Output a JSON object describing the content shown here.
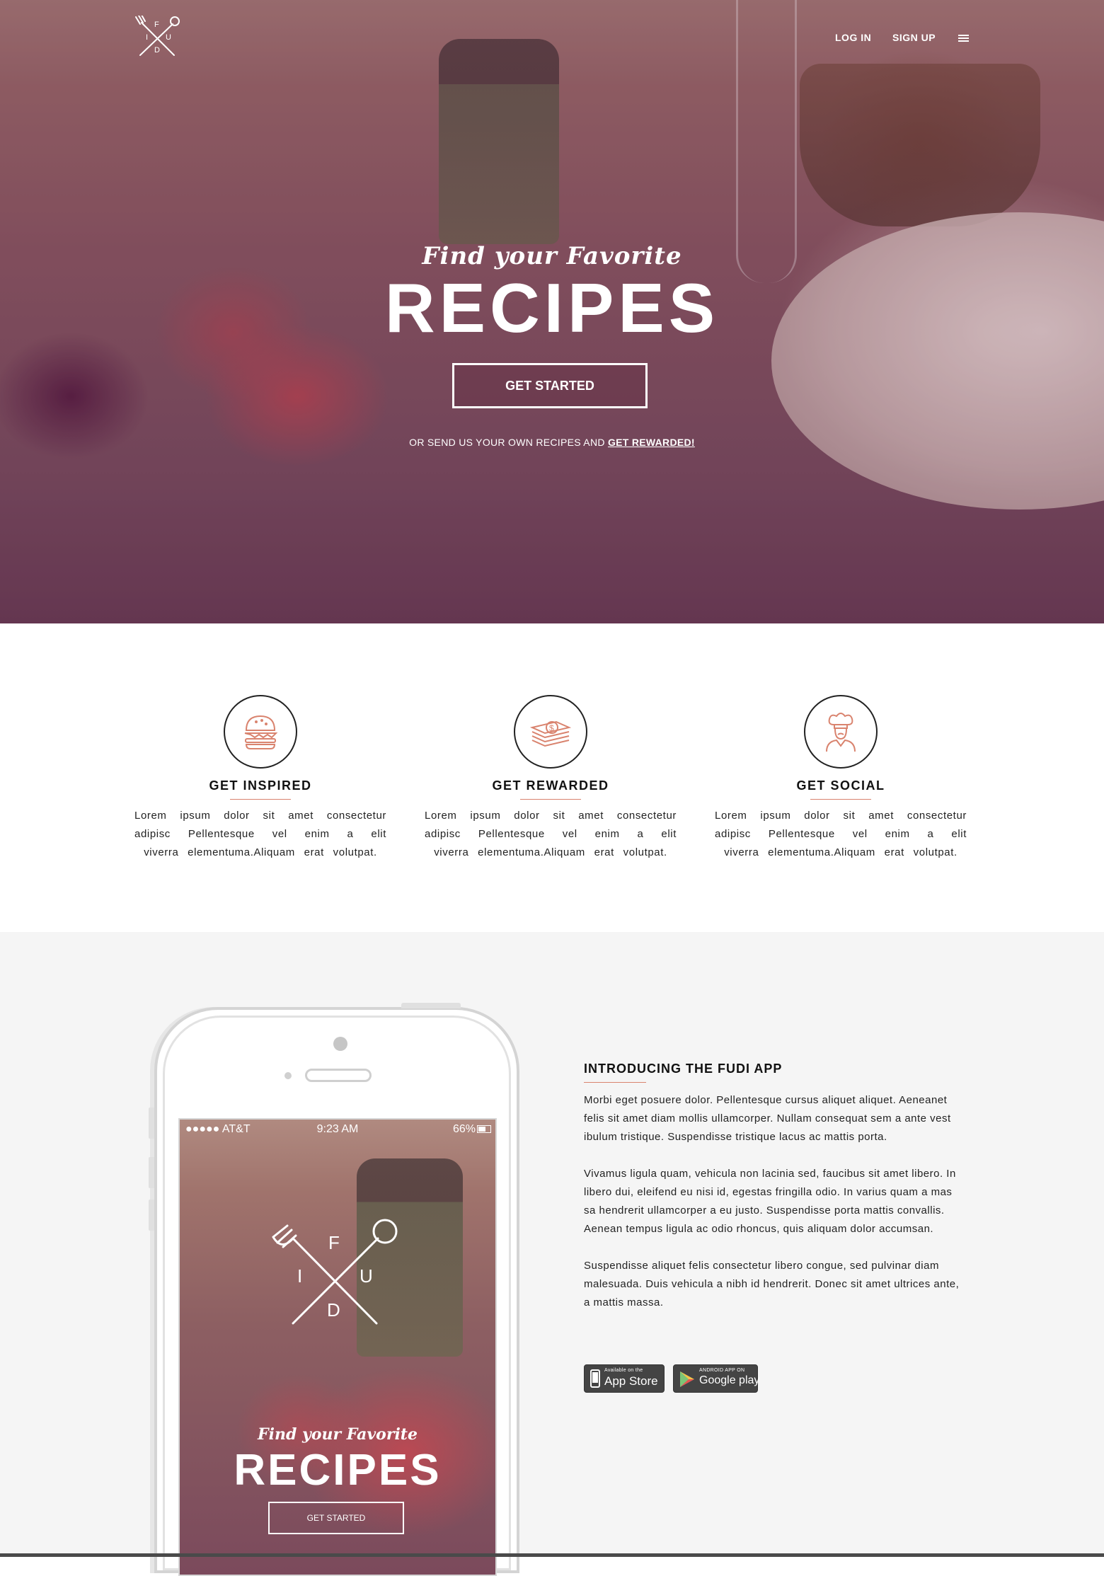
{
  "brand": {
    "logo_letters": [
      "F",
      "I",
      "U",
      "D"
    ]
  },
  "nav": {
    "login": "LOG IN",
    "signup": "SIGN UP"
  },
  "hero": {
    "subtitle": "Find your Favorite",
    "title": "RECIPES",
    "cta": "GET STARTED",
    "note_prefix": "OR SEND US YOUR OWN RECIPES AND",
    "note_link": "GET REWARDED!"
  },
  "features": [
    {
      "icon": "burger-icon",
      "title": "GET INSPIRED",
      "text": "Lorem ipsum dolor sit amet consectetur adipisc Pellentesque vel enim a elit viverra elementuma.Aliquam erat volutpat."
    },
    {
      "icon": "money-icon",
      "title": "GET REWARDED",
      "text": "Lorem ipsum dolor sit amet consectetur adipisc Pellentesque vel enim a elit viverra elementuma.Aliquam erat volutpat."
    },
    {
      "icon": "chef-icon",
      "title": "GET SOCIAL",
      "text": "Lorem ipsum dolor sit amet consectetur adipisc Pellentesque vel enim a elit viverra elementuma.Aliquam erat volutpat."
    }
  ],
  "phone": {
    "carrier": "●●●●● AT&T",
    "time": "9:23 AM",
    "battery": "66%",
    "subtitle": "Find your Favorite",
    "title": "RECIPES",
    "cta": "GET STARTED"
  },
  "app": {
    "heading": "INTRODUCING THE FUDI APP",
    "paragraphs": [
      "Morbi eget posuere dolor. Pellentesque cursus aliquet aliquet. Aeneanet felis sit amet diam mollis ullamcorper. Nullam consequat sem a ante vest ibulum tristique. Suspendisse tristique lacus ac mattis porta.",
      "Vivamus ligula quam, vehicula non lacinia sed, faucibus sit amet libero. In libero dui, eleifend eu nisi id, egestas fringilla odio. In varius quam a mas sa hendrerit ullamcorper a eu justo. Suspendisse porta mattis convallis. Aenean tempus ligula ac odio rhoncus, quis aliquam dolor accumsan.",
      "Suspendisse aliquet felis consectetur libero congue, sed pulvinar diam malesuada. Duis vehicula a nibh id hendrerit. Donec sit amet ultrices ante, a mattis massa."
    ],
    "stores": {
      "apple_small": "Available on the",
      "apple_big": "App Store",
      "google_small": "ANDROID APP ON",
      "google_big": "Google play"
    }
  },
  "colors": {
    "accent": "#d9836e",
    "hero_tint": "#7a4f60",
    "section_bg": "#f5f5f5"
  }
}
